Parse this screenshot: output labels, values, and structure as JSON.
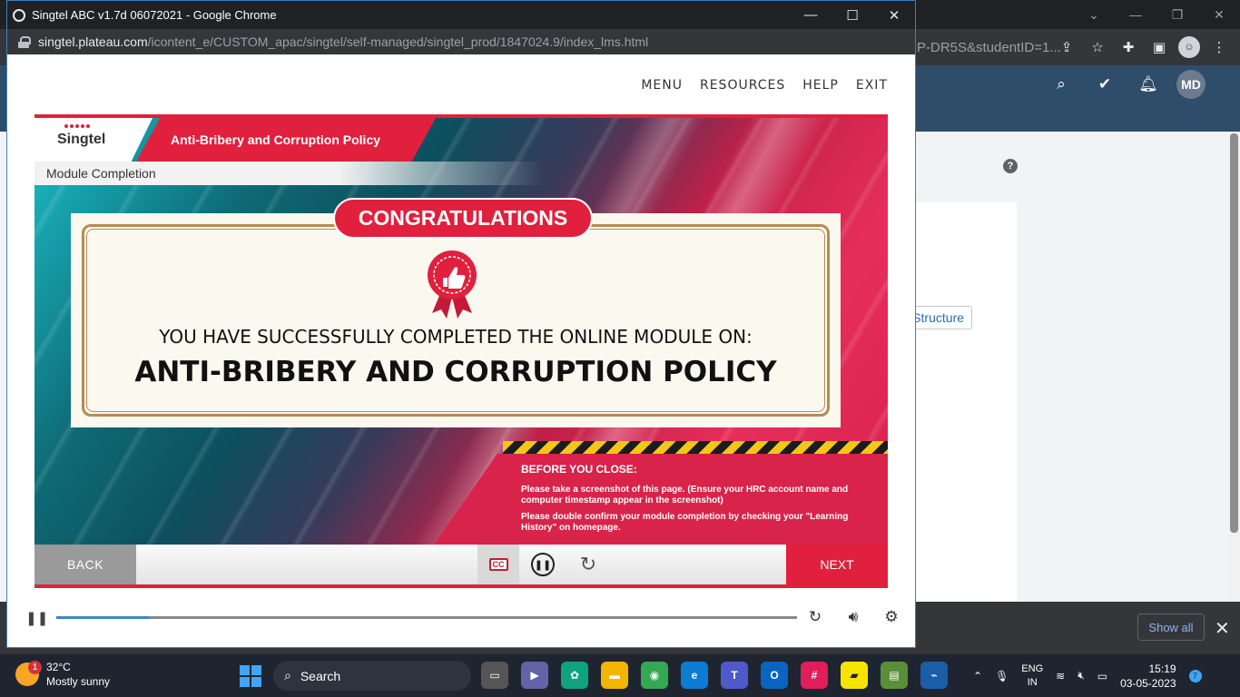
{
  "bg_browser": {
    "url_fragment": "P-DR5S&studentID=1...",
    "avatar_initials": "MD",
    "structure_button": "Structure",
    "help_icon": "?",
    "show_all": "Show all"
  },
  "popup": {
    "window_title": "Singtel ABC v1.7d 06072021 - Google Chrome",
    "url_host": "singtel.plateau.com",
    "url_path": "/icontent_e/CUSTOM_apac/singtel/self-managed/singtel_prod/1847024.9/index_lms.html"
  },
  "nav": {
    "menu": "MENU",
    "resources": "RESOURCES",
    "help": "HELP",
    "exit": "EXIT"
  },
  "course": {
    "logo": "Singtel",
    "title": "Anti-Bribery and Corruption Policy",
    "section": "Module Completion",
    "congrats": "CONGRATULATIONS",
    "line1": "YOU HAVE SUCCESSFULLY COMPLETED THE ONLINE MODULE ON:",
    "line2": "ANTI-BRIBERY AND CORRUPTION POLICY",
    "notice_heading": "BEFORE YOU CLOSE:",
    "notice_1": "Please take a screenshot of this page. (Ensure your HRC account name and computer timestamp appear in the screenshot)",
    "notice_2": "Please double confirm your module completion by checking your \"Learning History\" on homepage.",
    "back": "BACK",
    "next": "NEXT",
    "cc": "CC"
  },
  "player": {
    "progress_fraction": 0.125
  },
  "taskbar": {
    "temp": "32°C",
    "weather": "Mostly sunny",
    "weather_badge": "1",
    "search": "Search",
    "lang1": "ENG",
    "lang2": "IN",
    "time": "15:19",
    "date": "03-05-2023",
    "notif_count": "7"
  },
  "colors": {
    "brand_red": "#e0203d",
    "teal": "#0e6b76",
    "gold_frame": "#b58c52"
  }
}
